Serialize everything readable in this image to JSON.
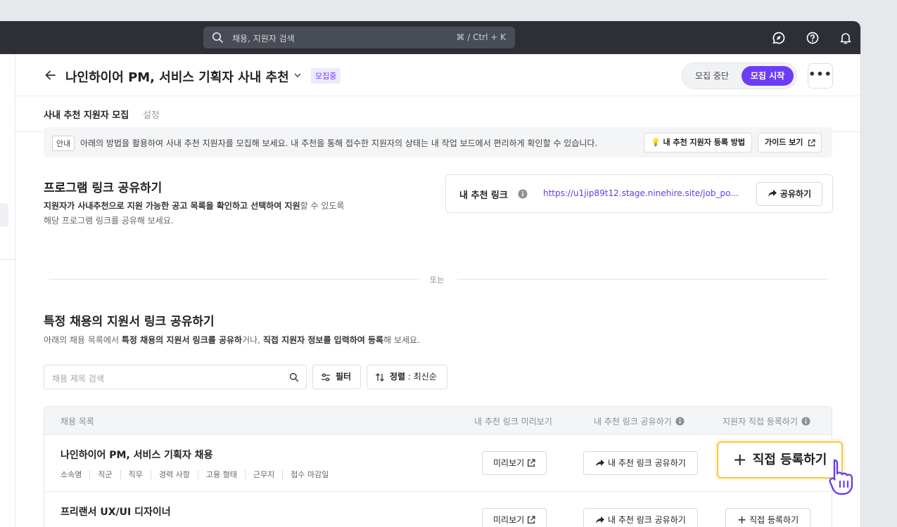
{
  "topbar": {
    "search_placeholder": "채용, 지원자 검색",
    "search_shortcut": "⌘ / Ctrl + K",
    "icons": [
      "chat-icon",
      "help-icon",
      "bell-icon"
    ]
  },
  "header": {
    "title": "나인하이어 PM, 서비스 기획자 사내 추천",
    "status_badge": "모집중",
    "stop_label": "모집 중단",
    "start_label": "모집 시작",
    "more_label": "•••"
  },
  "tabs": [
    {
      "label": "사내 추천 지원자 모집",
      "active": true
    },
    {
      "label": "설정",
      "active": false
    }
  ],
  "notice": {
    "tag": "안내",
    "message": "아래의 방법을 활용하여 사내 추천 지원자를 모집해 보세요. 내 추천을 통해 접수한 지원자의 상태는 내 작업 보드에서 편리하게 확인할 수 있습니다.",
    "how_to_label": "💡 내 추천 지원자 등록 방법",
    "guide_label": "가이드 보기"
  },
  "program_link": {
    "title": "프로그램 링크 공유하기",
    "desc_bold": "지원자가 사내추천으로 지원 가능한 공고 목록을 확인하고 선택하여 지원",
    "desc_rest": "할 수 있도록",
    "desc_line2": "해당 프로그램 링크를 공유해 보세요.",
    "link_label": "내 추천 링크",
    "link_url": "https://u1jip89t12.stage.ninehire.site/job_po...",
    "share_label": "공유하기"
  },
  "divider_text": "또는",
  "specific": {
    "title": "특정 채용의 지원서 링크 공유하기",
    "desc_1": "아래의 채용 목록에서 ",
    "desc_2": "특정 채용의 지원서 링크를 공유하",
    "desc_3": "거나, ",
    "desc_4": "직접 지원자 정보를 입력하여 등록",
    "desc_5": "해 보세요."
  },
  "list_controls": {
    "search_placeholder": "채용 제목 검색",
    "filter_label": "필터",
    "sort_label": "정렬",
    "sort_value": " : 최신순"
  },
  "table": {
    "headers": [
      "채용 목록",
      "내 추천 링크 미리보기",
      "내 추천 링크 공유하기",
      "지원자 직접 등록하기"
    ],
    "rows": [
      {
        "title": "나인하이어 PM, 서비스 기획자 채용",
        "meta": [
          "소속명",
          "직군",
          "직무",
          "경력 사항",
          "고용 형태",
          "근무지",
          "접수 마감일"
        ],
        "preview_label": "미리보기",
        "share_label": "내 추천 링크 공유하기",
        "register_label": "직접 등록하기"
      },
      {
        "title": "프리랜서 UX/UI 디자이너",
        "meta": [],
        "preview_label": "미리보기",
        "share_label": "내 추천 링크 공유하기",
        "register_label": "직접 등록하기"
      }
    ]
  },
  "colors": {
    "accent": "#6b3df7",
    "topbar": "#2c2f36",
    "highlight": "#f3c941"
  }
}
